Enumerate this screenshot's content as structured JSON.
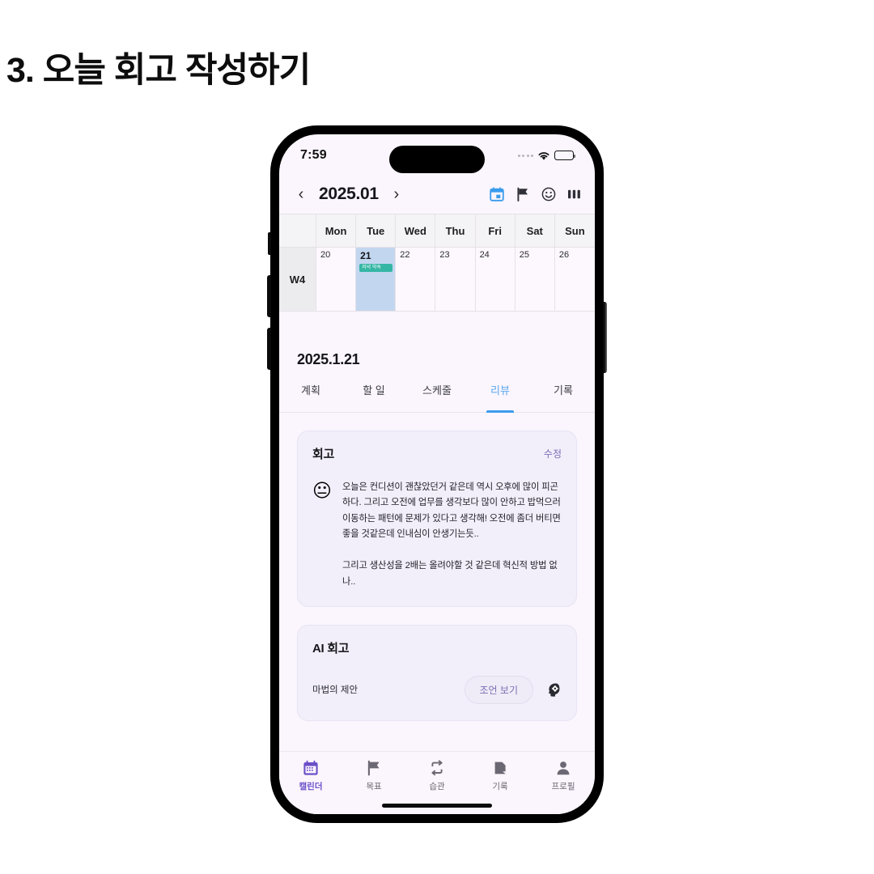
{
  "page": {
    "heading": "3. 오늘 회고 작성하기"
  },
  "status_bar": {
    "time": "7:59",
    "wifi_icon": "wifi-icon",
    "battery_icon": "battery-full-icon",
    "signal_icon": "signal-dots-icon"
  },
  "app_header": {
    "prev_label": "‹",
    "month": "2025.01",
    "next_label": "›",
    "icons": [
      {
        "name": "calendar-icon",
        "color": "#3b9ced"
      },
      {
        "name": "flag-icon",
        "color": "#2f2f38"
      },
      {
        "name": "emoji-smile-icon",
        "color": "#2f2f38"
      },
      {
        "name": "columns-view-icon",
        "color": "#2f2f38"
      }
    ]
  },
  "calendar": {
    "weekday_headers": [
      "",
      "Mon",
      "Tue",
      "Wed",
      "Thu",
      "Fri",
      "Sat",
      "Sun"
    ],
    "week_label": "W4",
    "days": [
      {
        "num": "20",
        "selected": false,
        "event": null
      },
      {
        "num": "21",
        "selected": true,
        "event": "저녁 약속"
      },
      {
        "num": "22",
        "selected": false,
        "event": null
      },
      {
        "num": "23",
        "selected": false,
        "event": null
      },
      {
        "num": "24",
        "selected": false,
        "event": null
      },
      {
        "num": "25",
        "selected": false,
        "event": null
      },
      {
        "num": "26",
        "selected": false,
        "event": null
      }
    ],
    "selected_cell_color": "#c2d6ef",
    "event_chip_color": "#35b6a4"
  },
  "detail": {
    "date": "2025.1.21",
    "tabs": [
      {
        "label": "계획",
        "active": false
      },
      {
        "label": "할 일",
        "active": false
      },
      {
        "label": "스케줄",
        "active": false
      },
      {
        "label": "리뷰",
        "active": true
      },
      {
        "label": "기록",
        "active": false
      }
    ],
    "active_tab_color": "#3b9ced"
  },
  "review_card": {
    "title": "회고",
    "edit_label": "수정",
    "mood_emoji": "😐",
    "body": "오늘은 컨디션이 괜찮았던거 같은데 역시 오후에 많이 피곤하다. 그리고 오전에 업무를 생각보다 많이 안하고 밥먹으러 이동하는 패턴에 문제가 있다고 생각해! 오전에 좀더 버티면 좋을 것같은데 인내심이 안생기는듯..\n\n그리고 생산성을 2배는 올려야할 것 같은데 혁신적 방법 없나.."
  },
  "ai_card": {
    "title": "AI 회고",
    "label": "마법의 제안",
    "button_label": "조언 보기",
    "icon": "ai-head-gear-icon"
  },
  "bottom_nav": {
    "items": [
      {
        "label": "캘린더",
        "icon": "calendar-icon",
        "active": true
      },
      {
        "label": "목표",
        "icon": "flag-icon",
        "active": false
      },
      {
        "label": "습관",
        "icon": "repeat-icon",
        "active": false
      },
      {
        "label": "기록",
        "icon": "document-icon",
        "active": false
      },
      {
        "label": "프로필",
        "icon": "person-icon",
        "active": false
      }
    ],
    "active_color": "#6a4fc8"
  }
}
